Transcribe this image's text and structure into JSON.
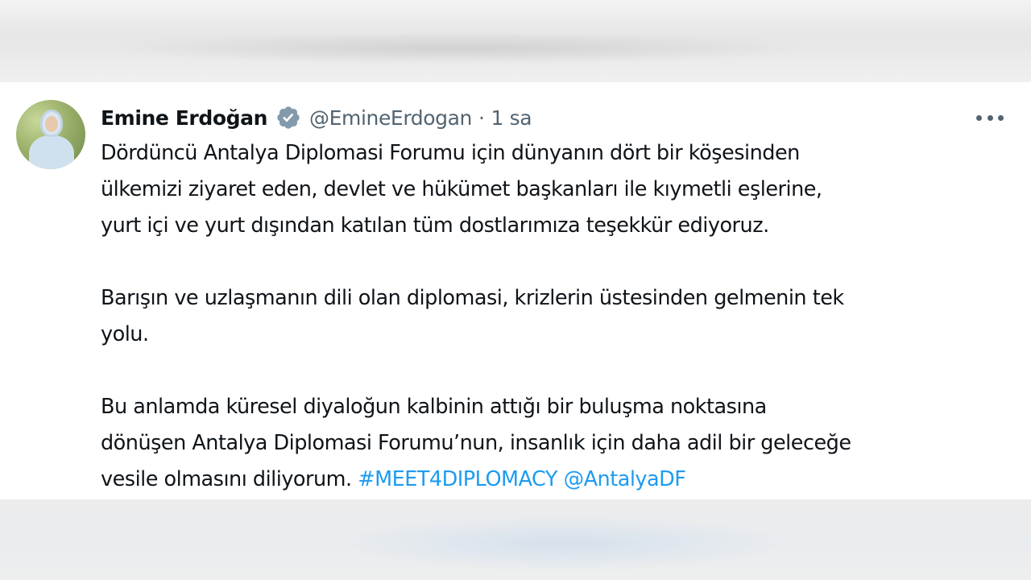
{
  "tweet": {
    "author_name": "Emine Erdoğan",
    "handle": "@EmineErdogan",
    "separator": "·",
    "time": "1 sa",
    "verified_icon": "verified-badge-icon",
    "more_icon": "more-options-icon",
    "paragraph1": {
      "line1": "Dördüncü Antalya Diplomasi Forumu için dünyanın dört bir köşesinden",
      "line2": "ülkemizi ziyaret eden, devlet ve hükümet başkanları ile kıymetli eşlerine,",
      "line3": "yurt içi ve yurt dışından katılan tüm dostlarımıza teşekkür ediyoruz."
    },
    "paragraph2": {
      "line1": "Barışın ve uzlaşmanın dili olan diplomasi, krizlerin üstesinden gelmenin tek",
      "line2": "yolu."
    },
    "paragraph3": {
      "line1": "Bu anlamda küresel diyaloğun kalbinin attığı bir buluşma noktasına",
      "line2": "dönüşen Antalya Diplomasi Forumu’nun, insanlık için daha adil bir geleceğe",
      "line3": "vesile olmasını diliyorum.",
      "hashtag": "#MEET4DIPLOMACY",
      "mention": "@AntalyaDF"
    },
    "colors": {
      "link": "#1d9bf0",
      "text": "#0f1419",
      "secondary": "#536471",
      "verified_badge": "#829aab"
    }
  }
}
